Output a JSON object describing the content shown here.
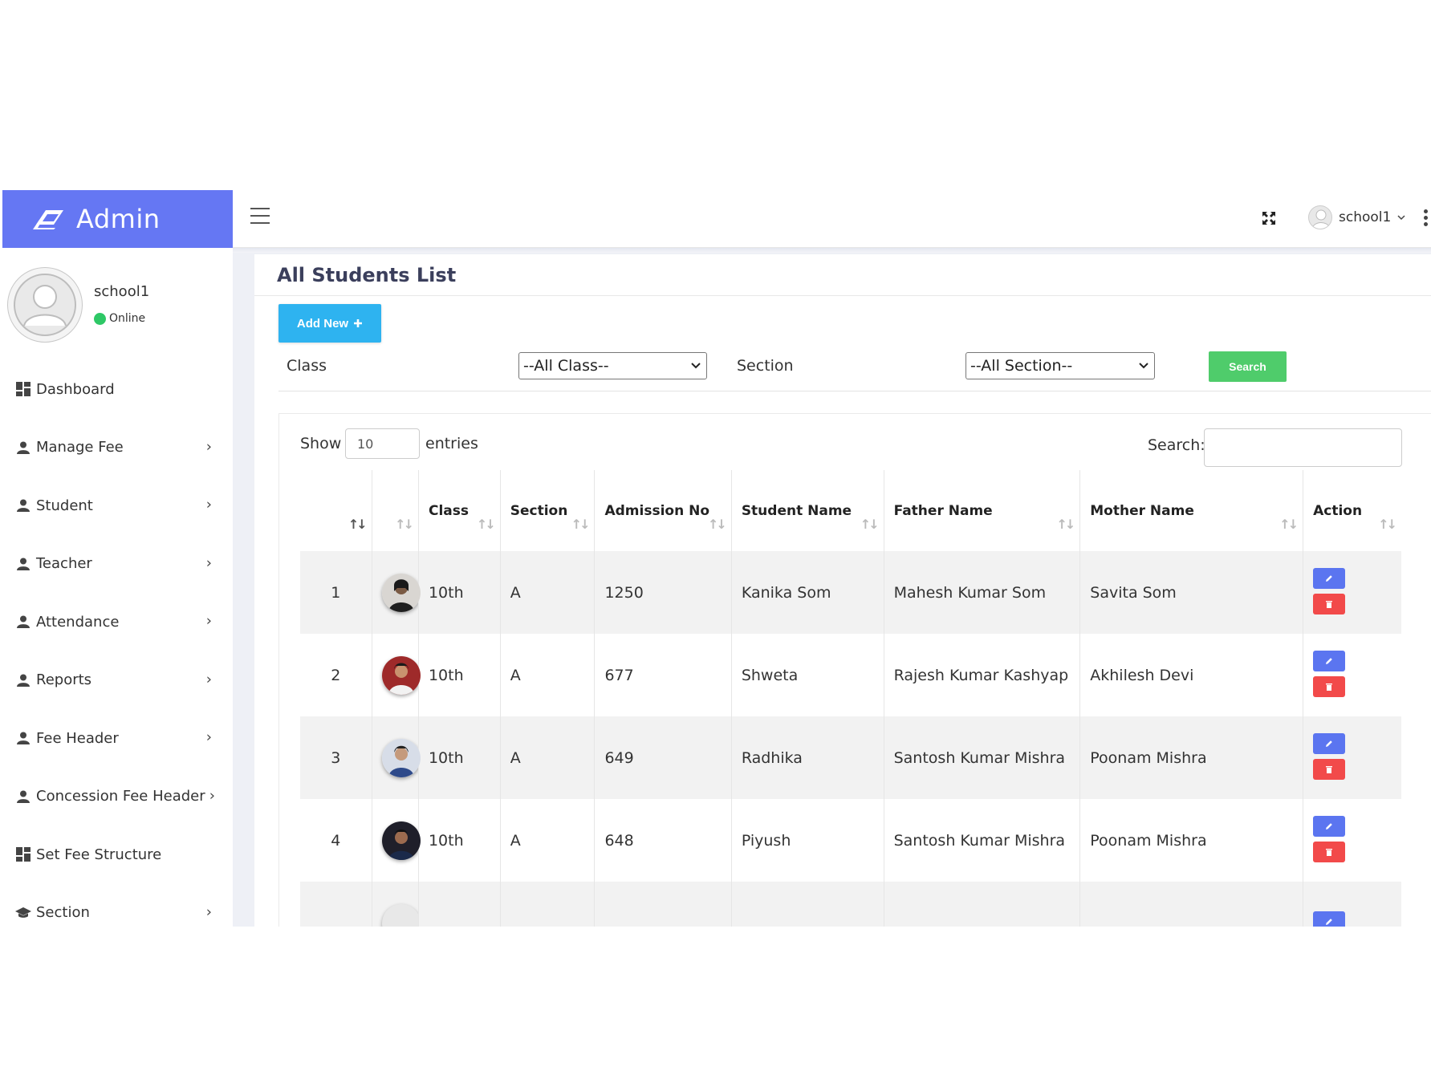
{
  "brand": {
    "name": "Admin",
    "color": "#6577f3"
  },
  "sidebar": {
    "user": {
      "name": "school1",
      "status": "Online"
    },
    "items": [
      {
        "label": "Dashboard",
        "icon": "dashboard-icon",
        "has_submenu": false
      },
      {
        "label": "Manage Fee",
        "icon": "user-icon",
        "has_submenu": true
      },
      {
        "label": "Student",
        "icon": "user-icon",
        "has_submenu": true
      },
      {
        "label": "Teacher",
        "icon": "user-icon",
        "has_submenu": true
      },
      {
        "label": "Attendance",
        "icon": "user-icon",
        "has_submenu": true
      },
      {
        "label": "Reports",
        "icon": "user-icon",
        "has_submenu": true
      },
      {
        "label": "Fee Header",
        "icon": "user-icon",
        "has_submenu": true
      },
      {
        "label": "Concession Fee Header",
        "icon": "user-icon",
        "has_submenu": true
      },
      {
        "label": "Set Fee Structure",
        "icon": "dashboard-icon",
        "has_submenu": false
      },
      {
        "label": "Section",
        "icon": "graduation-cap-icon",
        "has_submenu": true
      }
    ]
  },
  "topbar": {
    "user_name": "school1"
  },
  "page": {
    "title": "All Students List",
    "add_new_label": "Add New",
    "filters": {
      "class_label": "Class",
      "class_value": "--All Class--",
      "section_label": "Section",
      "section_value": "--All Section--",
      "search_button": "Search"
    },
    "table_controls": {
      "show_label": "Show",
      "entries_value": "10",
      "entries_label": "entries",
      "search_label": "Search:",
      "search_value": ""
    },
    "table": {
      "columns": [
        "",
        "",
        "Class",
        "Section",
        "Admission No",
        "Student Name",
        "Father Name",
        "Mother Name",
        "Action"
      ],
      "rows": [
        {
          "sn": "1",
          "class": "10th",
          "section": "A",
          "admission_no": "1250",
          "student_name": "Kanika Som",
          "father_name": "Mahesh Kumar Som",
          "mother_name": "Savita Som"
        },
        {
          "sn": "2",
          "class": "10th",
          "section": "A",
          "admission_no": "677",
          "student_name": "Shweta",
          "father_name": "Rajesh Kumar Kashyap",
          "mother_name": "Akhilesh Devi"
        },
        {
          "sn": "3",
          "class": "10th",
          "section": "A",
          "admission_no": "649",
          "student_name": "Radhika",
          "father_name": "Santosh Kumar Mishra",
          "mother_name": "Poonam Mishra"
        },
        {
          "sn": "4",
          "class": "10th",
          "section": "A",
          "admission_no": "648",
          "student_name": "Piyush",
          "father_name": "Santosh Kumar Mishra",
          "mother_name": "Poonam Mishra"
        },
        {
          "sn": "",
          "class": "",
          "section": "",
          "admission_no": "",
          "student_name": "",
          "father_name": "",
          "mother_name": ""
        }
      ]
    }
  },
  "colors": {
    "edit": "#5b75f0",
    "delete": "#f24a4a",
    "add": "#2eb3f0",
    "search": "#4fcc6b",
    "online": "#2ec866"
  }
}
